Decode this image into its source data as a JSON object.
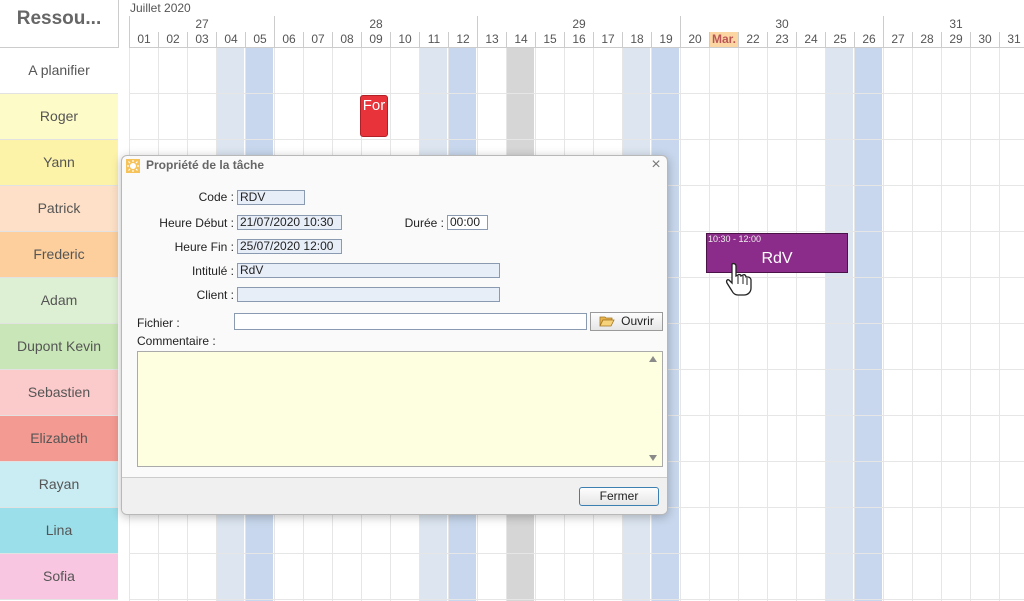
{
  "corner_title": "Ressou...",
  "month_label": "Juillet 2020",
  "weeks": [
    "27",
    "28",
    "29",
    "30",
    "31"
  ],
  "days": [
    "01",
    "02",
    "03",
    "04",
    "05",
    "06",
    "07",
    "08",
    "09",
    "10",
    "11",
    "12",
    "13",
    "14",
    "15",
    "16",
    "17",
    "18",
    "19",
    "20",
    "Mar.",
    "22",
    "23",
    "24",
    "25",
    "26",
    "27",
    "28",
    "29",
    "30",
    "31"
  ],
  "today_label": "Mar.",
  "resources": [
    {
      "label": "A planifier",
      "color": "#ffffff"
    },
    {
      "label": "Roger",
      "color": "#fdfbc7"
    },
    {
      "label": "Yann",
      "color": "#fdf3a8"
    },
    {
      "label": "Patrick",
      "color": "#fde0c7"
    },
    {
      "label": "Frederic",
      "color": "#fccf9d"
    },
    {
      "label": "Adam",
      "color": "#def0d4"
    },
    {
      "label": "Dupont Kevin",
      "color": "#c8e6b7"
    },
    {
      "label": "Sebastien",
      "color": "#fbcaca"
    },
    {
      "label": "Elizabeth",
      "color": "#f39a92"
    },
    {
      "label": "Rayan",
      "color": "#caedf4"
    },
    {
      "label": "Lina",
      "color": "#9bdfea"
    },
    {
      "label": "Sofia",
      "color": "#f9c6e1"
    }
  ],
  "events": {
    "for": {
      "label": "For",
      "color": "#e8333a"
    },
    "rdv": {
      "time": "10:30 - 12:00",
      "label": "RdV",
      "color": "#8c2c8a"
    }
  },
  "dialog": {
    "title": "Propriété de la tâche",
    "code_label": "Code :",
    "code_value": "RDV",
    "debut_label": "Heure Début :",
    "debut_value": "21/07/2020 10:30",
    "duree_label": "Durée :",
    "duree_value": "00:00",
    "fin_label": "Heure Fin :",
    "fin_value": "25/07/2020 12:00",
    "intitule_label": "Intitulé :",
    "intitule_value": "RdV",
    "client_label": "Client :",
    "client_value": "",
    "fichier_label": "Fichier :",
    "fichier_value": "",
    "ouvrir_label": "Ouvrir",
    "commentaire_label": "Commentaire :",
    "commentaire_value": "",
    "fermer_label": "Fermer",
    "close_glyph": "×"
  }
}
